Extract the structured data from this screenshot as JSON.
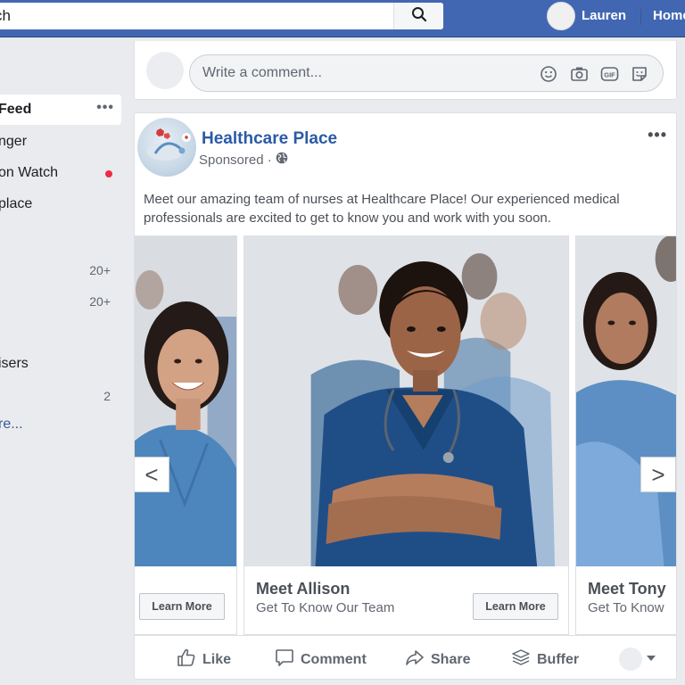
{
  "topbar": {
    "search_value": "ch",
    "user_name": "Lauren",
    "home_label": "Home",
    "brand_color": "#4267b2"
  },
  "sidebar": {
    "items": [
      {
        "label": "Feed",
        "active": true
      },
      {
        "label": "nger"
      },
      {
        "label": "on Watch",
        "notification": true
      },
      {
        "label": "place"
      },
      {
        "label": "",
        "count": "20+"
      },
      {
        "label": "",
        "count": "20+"
      },
      {
        "label": "isers"
      },
      {
        "label": "",
        "count": "2"
      },
      {
        "label": "re..."
      }
    ]
  },
  "comment_box": {
    "placeholder": "Write a comment...",
    "icons": [
      "emoji-icon",
      "camera-icon",
      "gif-icon",
      "sticker-icon"
    ]
  },
  "post": {
    "page_name": "Healthcare Place",
    "sponsored_label": "Sponsored ·",
    "text": "Meet our amazing team of nurses at Healthcare Place! Our experienced medical professionals are excited to get to know you and work with you soon.",
    "carousel": [
      {
        "title": "",
        "subtitle": "",
        "button": "Learn More"
      },
      {
        "title": "Meet Allison",
        "subtitle": "Get To Know Our Team",
        "button": "Learn More"
      },
      {
        "title": "Meet Tony",
        "subtitle": "Get To Know",
        "button": ""
      }
    ],
    "arrows": {
      "prev": "<",
      "next": ">"
    },
    "actions": {
      "like": "Like",
      "comment": "Comment",
      "share": "Share",
      "buffer": "Buffer"
    }
  },
  "colors": {
    "link": "#2a5aa6",
    "scrubs": "#2f6aa8",
    "notification_dot": "#f02849"
  }
}
